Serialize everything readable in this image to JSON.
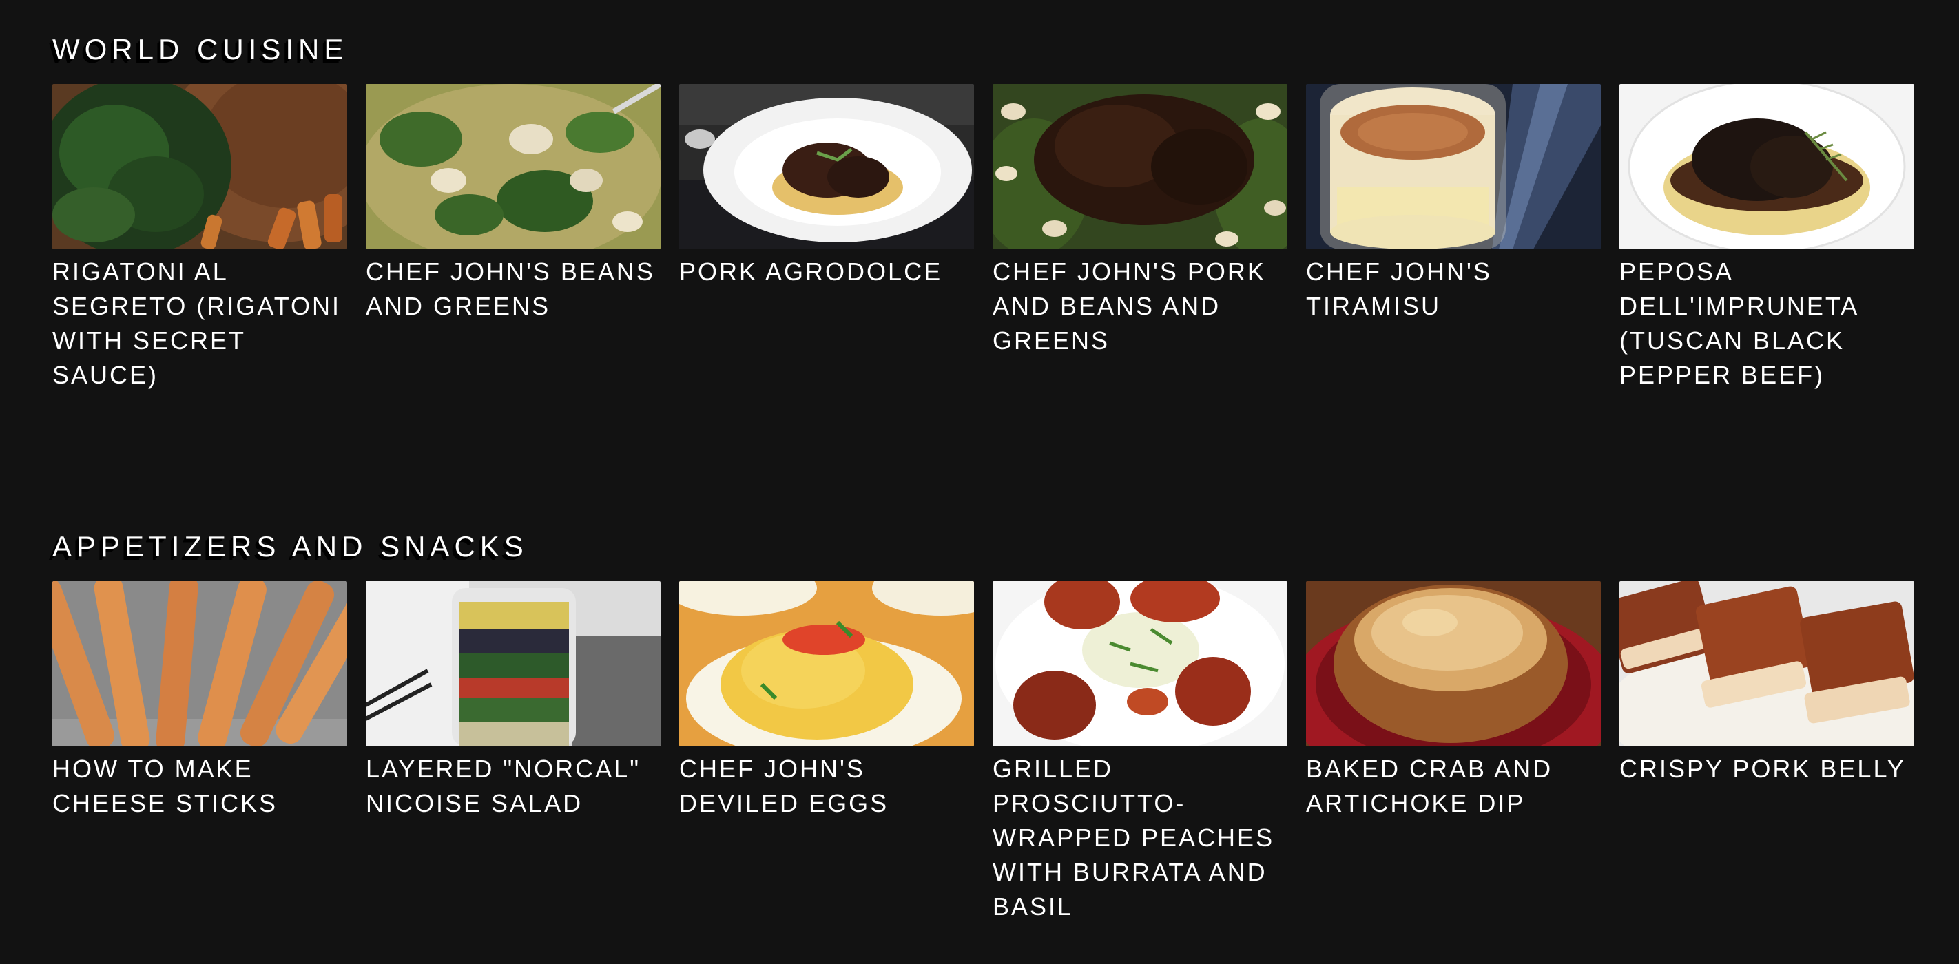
{
  "sections": [
    {
      "title": "WORLD CUISINE",
      "items": [
        {
          "title": "RIGATONI AL SEGRETO (RIGATONI WITH SECRET SAUCE)",
          "icon": "rigatoni-photo"
        },
        {
          "title": "CHEF JOHN'S BEANS AND GREENS",
          "icon": "beans-greens-photo"
        },
        {
          "title": "PORK AGRODOLCE",
          "icon": "pork-agrodolce-photo"
        },
        {
          "title": "CHEF JOHN'S PORK AND BEANS AND GREENS",
          "icon": "pork-beans-greens-photo"
        },
        {
          "title": "CHEF JOHN'S TIRAMISU",
          "icon": "tiramisu-photo"
        },
        {
          "title": "PEPOSA DELL'IMPRUNETA (TUSCAN BLACK PEPPER BEEF)",
          "icon": "peposa-photo"
        }
      ]
    },
    {
      "title": "APPETIZERS AND SNACKS",
      "items": [
        {
          "title": "HOW TO MAKE CHEESE STICKS",
          "icon": "cheese-sticks-photo"
        },
        {
          "title": "LAYERED \"NORCAL\" NICOISE SALAD",
          "icon": "nicoise-salad-photo"
        },
        {
          "title": "CHEF JOHN'S DEVILED EGGS",
          "icon": "deviled-eggs-photo"
        },
        {
          "title": "GRILLED PROSCIUTTO-WRAPPED PEACHES WITH BURRATA AND BASIL",
          "icon": "prosciutto-peaches-photo"
        },
        {
          "title": "BAKED CRAB AND ARTICHOKE DIP",
          "icon": "crab-dip-photo"
        },
        {
          "title": "CRISPY PORK BELLY",
          "icon": "pork-belly-photo"
        }
      ]
    }
  ],
  "colors": {
    "background": "#121212",
    "text": "#ffffff"
  }
}
